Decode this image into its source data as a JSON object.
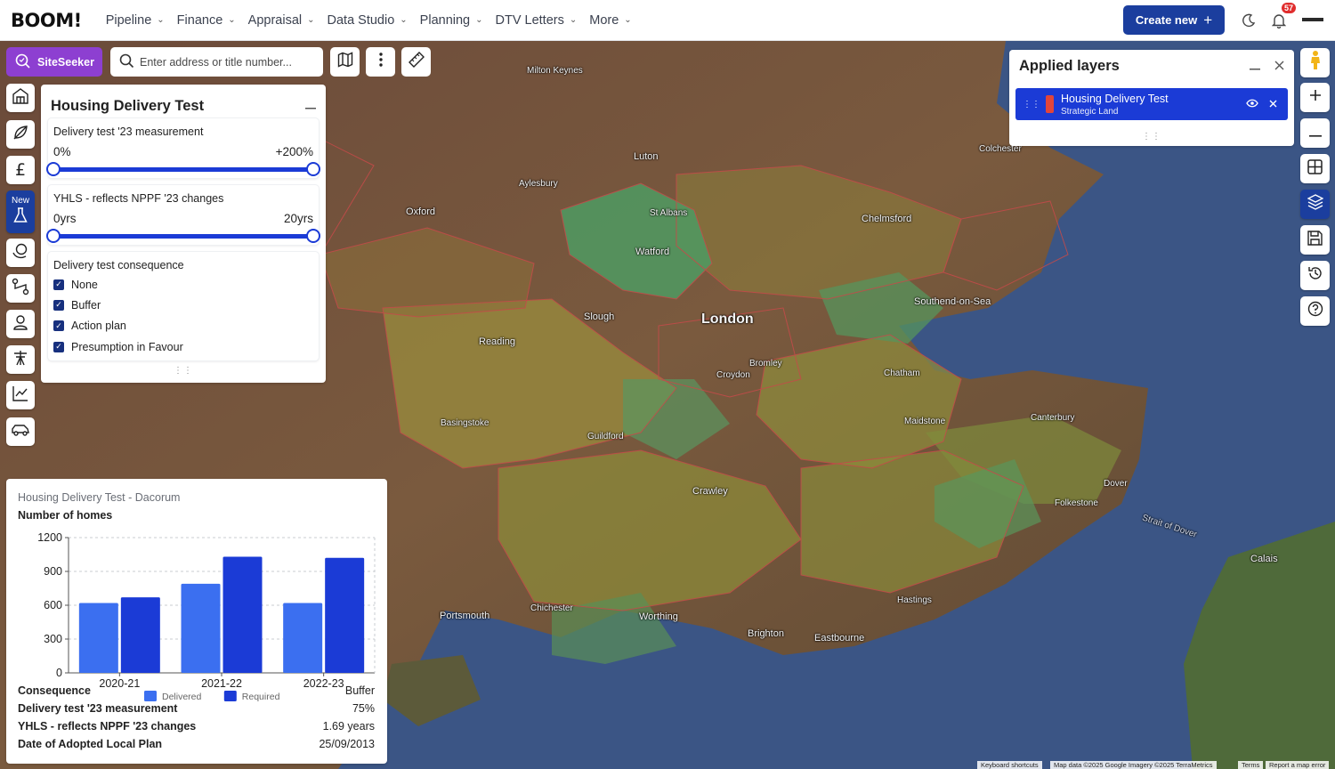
{
  "app": {
    "logo": "BOOM!",
    "nav": [
      {
        "label": "Pipeline"
      },
      {
        "label": "Finance"
      },
      {
        "label": "Appraisal"
      },
      {
        "label": "Data Studio"
      },
      {
        "label": "Planning"
      },
      {
        "label": "DTV Letters"
      },
      {
        "label": "More"
      }
    ],
    "create_label": "Create new",
    "notification_count": "57"
  },
  "search": {
    "siteseeker_label": "SiteSeeker",
    "placeholder": "Enter address or title number..."
  },
  "rail": {
    "new_tag": "New"
  },
  "filter_panel": {
    "title": "Housing Delivery Test",
    "measurement": {
      "title": "Delivery test '23 measurement",
      "min": "0%",
      "max": "+200%"
    },
    "yhls": {
      "title": "YHLS - reflects NPPF '23 changes",
      "min": "0yrs",
      "max": "20yrs"
    },
    "consequence": {
      "title": "Delivery test consequence",
      "options": [
        {
          "label": "None",
          "checked": true
        },
        {
          "label": "Buffer",
          "checked": true
        },
        {
          "label": "Action plan",
          "checked": true
        },
        {
          "label": "Presumption in Favour",
          "checked": true
        }
      ]
    }
  },
  "chart_panel": {
    "title": "Housing Delivery Test - Dacorum",
    "subtitle": "Number of homes",
    "stats": [
      {
        "label": "Consequence",
        "value": "Buffer"
      },
      {
        "label": "Delivery test '23 measurement",
        "value": "75%"
      },
      {
        "label": "YHLS - reflects NPPF '23 changes",
        "value": "1.69 years"
      },
      {
        "label": "Date of Adopted Local Plan",
        "value": "25/09/2013"
      }
    ]
  },
  "chart_data": {
    "type": "bar",
    "title": "Number of homes",
    "categories": [
      "2020-21",
      "2021-22",
      "2022-23"
    ],
    "series": [
      {
        "name": "Delivered",
        "values": [
          620,
          790,
          620
        ],
        "color": "#3b6ff0"
      },
      {
        "name": "Required",
        "values": [
          670,
          1030,
          1020
        ],
        "color": "#1b3bd6"
      }
    ],
    "yticks": [
      "0",
      "300",
      "600",
      "900",
      "1200"
    ],
    "ylim": [
      0,
      1200
    ],
    "legend": "bottom",
    "grid": true
  },
  "layers_panel": {
    "title": "Applied layers",
    "items": [
      {
        "name": "Housing Delivery Test",
        "sub": "Strategic Land",
        "color": "#e2453a"
      }
    ]
  },
  "map": {
    "labels": [
      {
        "text": "London",
        "size": "big"
      },
      {
        "text": "Luton",
        "size": "med"
      },
      {
        "text": "Watford",
        "size": "med"
      },
      {
        "text": "St Albans",
        "size": "sm"
      },
      {
        "text": "Chelmsford",
        "size": "med"
      },
      {
        "text": "Colchester",
        "size": "sm"
      },
      {
        "text": "Southend-on-Sea",
        "size": "med"
      },
      {
        "text": "Reading",
        "size": "med"
      },
      {
        "text": "Oxford",
        "size": "med"
      },
      {
        "text": "Crawley",
        "size": "med"
      },
      {
        "text": "Brighton",
        "size": "med"
      },
      {
        "text": "Worthing",
        "size": "med"
      },
      {
        "text": "Eastbourne",
        "size": "med"
      },
      {
        "text": "Portsmouth",
        "size": "med"
      },
      {
        "text": "Chichester",
        "size": "sm"
      },
      {
        "text": "Canterbury",
        "size": "sm"
      },
      {
        "text": "Folkestone",
        "size": "sm"
      },
      {
        "text": "Dover",
        "size": "sm"
      },
      {
        "text": "Maidstone",
        "size": "sm"
      },
      {
        "text": "Chatham",
        "size": "sm"
      },
      {
        "text": "Guildford",
        "size": "sm"
      },
      {
        "text": "Basingstoke",
        "size": "sm"
      },
      {
        "text": "Calais",
        "size": "med"
      },
      {
        "text": "Hastings",
        "size": "sm"
      },
      {
        "text": "Milton Keynes",
        "size": "sm"
      },
      {
        "text": "Aylesbury",
        "size": "sm"
      },
      {
        "text": "Slough",
        "size": "med"
      },
      {
        "text": "Bromley",
        "size": "sm"
      },
      {
        "text": "Croydon",
        "size": "sm"
      },
      {
        "text": "Strait of Dover",
        "size": "sm"
      }
    ],
    "attribution": [
      "Keyboard shortcuts",
      "Map data ©2025 Google Imagery ©2025 TerraMetrics",
      "Terms",
      "Report a map error"
    ]
  }
}
